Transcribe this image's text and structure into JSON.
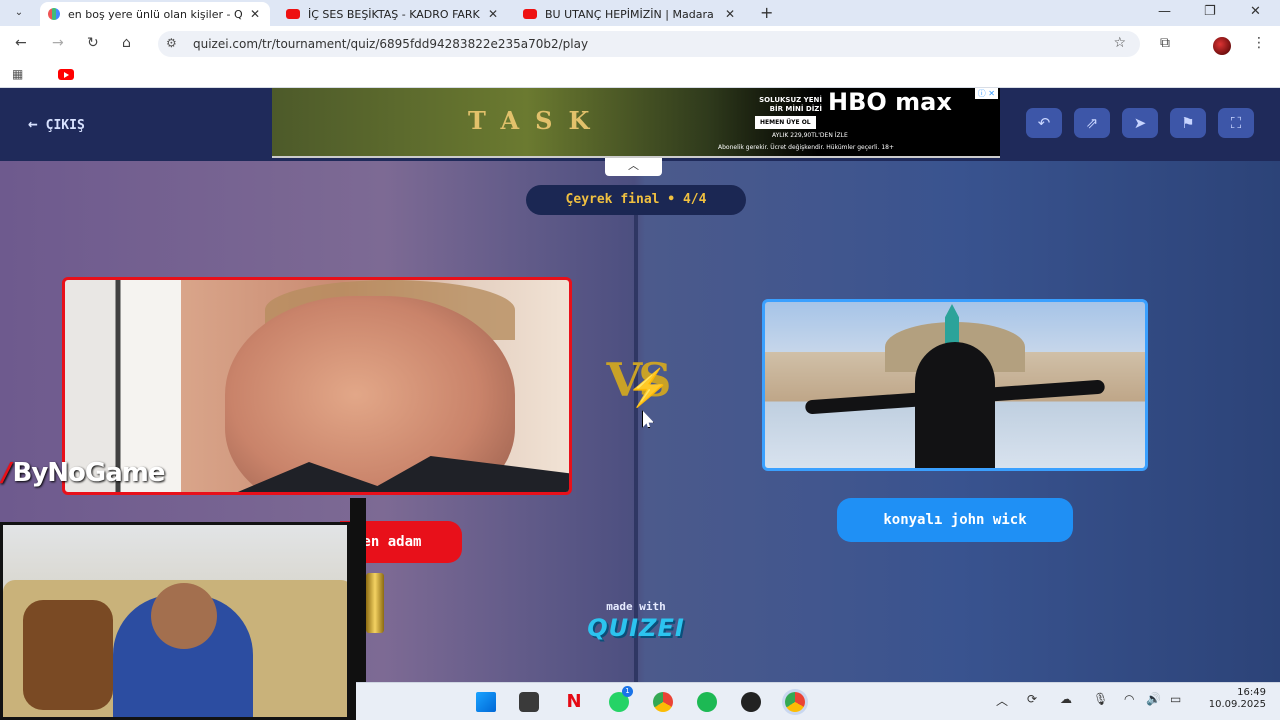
{
  "browser": {
    "tabs": [
      {
        "title": "en boş yere ünlü olan kişiler - Q",
        "active": true,
        "favicon": "multicolor-favicon"
      },
      {
        "title": "İÇ SES BEŞİKTAŞ - KADRO FARK",
        "active": false,
        "favicon": "youtube-icon"
      },
      {
        "title": "BU UTANÇ HEPİMİZİN | Madara",
        "active": false,
        "favicon": "youtube-icon"
      }
    ],
    "url": "quizei.com/tr/tournament/quiz/6895fdd94283822e235a70b2/play"
  },
  "page": {
    "back_label": "ÇIKIŞ",
    "round_label": "Çeyrek final • 4/4",
    "left_choice_label": "yen adam",
    "right_choice_label": "konyalı john wick",
    "vs_text": "VS",
    "made_with": "made with",
    "brand": "QUIZEI"
  },
  "ad": {
    "title": "TASK",
    "line1": "SOLUKSUZ YENİ BİR MİNİ DİZİ",
    "cta": "HEMEN ÜYE OL",
    "brand": "HBO max",
    "price": "AYLIK 229,90TL'DEN İZLE",
    "legal": "Abonelik gerekir. Ücret değişkendir. Hükümler geçerli. 18+"
  },
  "overlay": {
    "watermark": "ByNoGame"
  },
  "taskbar": {
    "badge_count": "1",
    "time": "16:49",
    "date": "10.09.2025"
  },
  "colors": {
    "left_accent": "#e8101a",
    "right_accent": "#1f90f5",
    "round_text": "#f0c040",
    "header_bg": "#1f2a5a"
  }
}
